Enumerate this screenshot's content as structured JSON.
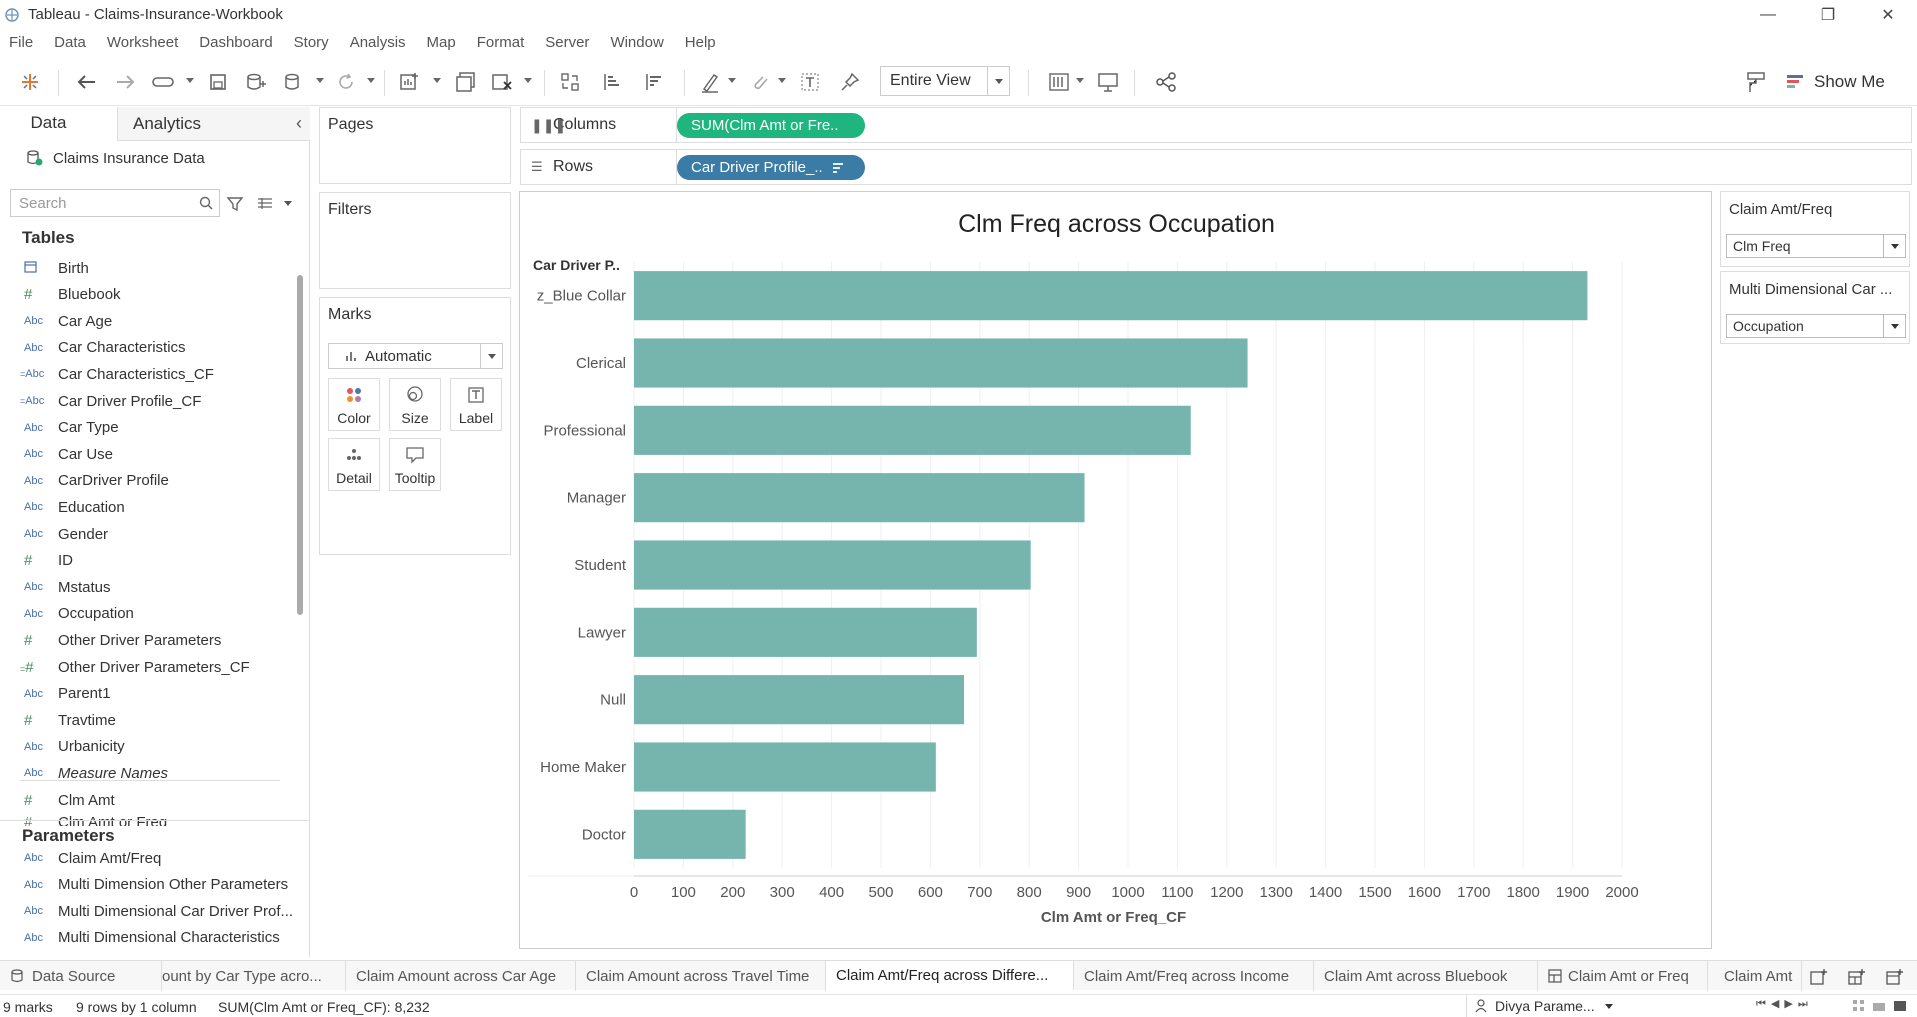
{
  "window": {
    "title": "Tableau - Claims-Insurance-Workbook"
  },
  "menu": [
    "File",
    "Data",
    "Worksheet",
    "Dashboard",
    "Story",
    "Analysis",
    "Map",
    "Format",
    "Server",
    "Window",
    "Help"
  ],
  "toolbar": {
    "fit_value": "Entire View",
    "show_me": "Show Me"
  },
  "datapane": {
    "tab_data": "Data",
    "tab_analytics": "Analytics",
    "data_source": "Claims Insurance Data",
    "search_placeholder": "Search",
    "tables_header": "Tables",
    "fields": [
      {
        "type": "date",
        "icon": "calendar-icon",
        "name": "Birth"
      },
      {
        "type": "measure",
        "icon": "hash-icon",
        "name": "Bluebook"
      },
      {
        "type": "text",
        "icon": "abc-icon",
        "name": "Car Age"
      },
      {
        "type": "text",
        "icon": "abc-icon",
        "name": "Car Characteristics"
      },
      {
        "type": "calc-text",
        "icon": "calc-abc-icon",
        "name": "Car Characteristics_CF"
      },
      {
        "type": "calc-text",
        "icon": "calc-abc-icon",
        "name": "Car Driver Profile_CF"
      },
      {
        "type": "text",
        "icon": "abc-icon",
        "name": "Car Type"
      },
      {
        "type": "text",
        "icon": "abc-icon",
        "name": "Car Use"
      },
      {
        "type": "text",
        "icon": "abc-icon",
        "name": "CarDriver Profile"
      },
      {
        "type": "text",
        "icon": "abc-icon",
        "name": "Education"
      },
      {
        "type": "text",
        "icon": "abc-icon",
        "name": "Gender"
      },
      {
        "type": "measure",
        "icon": "hash-icon",
        "name": "ID"
      },
      {
        "type": "text",
        "icon": "abc-icon",
        "name": "Mstatus"
      },
      {
        "type": "text",
        "icon": "abc-icon",
        "name": "Occupation"
      },
      {
        "type": "measure",
        "icon": "hash-icon",
        "name": "Other Driver Parameters"
      },
      {
        "type": "calc-measure",
        "icon": "calc-hash-icon",
        "name": "Other Driver Parameters_CF"
      },
      {
        "type": "text",
        "icon": "abc-icon",
        "name": "Parent1"
      },
      {
        "type": "measure",
        "icon": "hash-icon",
        "name": "Travtime"
      },
      {
        "type": "text",
        "icon": "abc-icon",
        "name": "Urbanicity"
      },
      {
        "type": "text-italic",
        "icon": "abc-icon",
        "name": "Measure Names"
      },
      {
        "type": "measure",
        "icon": "hash-icon",
        "name": "Clm Amt"
      },
      {
        "type": "measure",
        "icon": "hash-icon",
        "name": "Clm Amt or Freq"
      }
    ],
    "parameters_header": "Parameters",
    "parameters": [
      "Claim Amt/Freq",
      "Multi Dimension Other Parameters",
      "Multi Dimensional Car Driver Prof...",
      "Multi Dimensional Characteristics"
    ]
  },
  "cards": {
    "pages": "Pages",
    "filters": "Filters",
    "marks": "Marks",
    "mark_type": "Automatic",
    "mark_buttons": [
      "Color",
      "Size",
      "Label",
      "Detail",
      "Tooltip"
    ]
  },
  "shelves": {
    "columns_label": "Columns",
    "columns_pill": "SUM(Clm Amt or Fre..",
    "rows_label": "Rows",
    "rows_pill": "Car Driver Profile_.."
  },
  "viz": {
    "row_header": "Car Driver P..",
    "bar_color": "#76b5ae"
  },
  "chart_data": {
    "type": "bar",
    "orientation": "horizontal",
    "title": "Clm Freq across Occupation",
    "xlabel": "Clm Amt or Freq_CF",
    "ylabel": "Car Driver P..",
    "categories": [
      "z_Blue Collar",
      "Clerical",
      "Professional",
      "Manager",
      "Student",
      "Lawyer",
      "Null",
      "Home Maker",
      "Doctor"
    ],
    "values": [
      1930,
      1242,
      1127,
      912,
      803,
      694,
      668,
      611,
      226
    ],
    "xlim": [
      0,
      2000
    ],
    "xticks": [
      0,
      100,
      200,
      300,
      400,
      500,
      600,
      700,
      800,
      900,
      1000,
      1100,
      1200,
      1300,
      1400,
      1500,
      1600,
      1700,
      1800,
      1900,
      2000
    ],
    "grid": true
  },
  "right_panels": {
    "param1_title": "Claim Amt/Freq",
    "param1_value": "Clm Freq",
    "param2_title": "Multi Dimensional Car ...",
    "param2_value": "Occupation"
  },
  "sheet_tabs": {
    "data_source": "Data Source",
    "tabs": [
      "ount by Car Type acro...",
      "Claim Amount across Car Age",
      "Claim Amount across Travel Time",
      "Claim Amt/Freq across Differe...",
      "Claim Amt/Freq across Income",
      "Claim Amt across Bluebook",
      "Claim Amt or Freq",
      "Claim Amt"
    ],
    "active_index": 3
  },
  "status": {
    "marks": "9 marks",
    "dims": "9 rows by 1 column",
    "sum": "SUM(Clm Amt or Freq_CF): 8,232",
    "user": "Divya Parame..."
  }
}
